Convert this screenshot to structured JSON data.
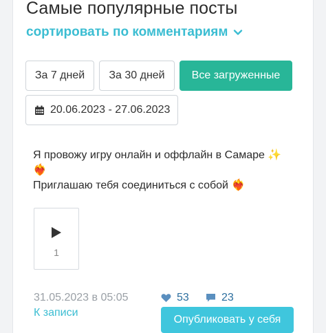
{
  "header": {
    "title": "Самые популярные посты",
    "sort_label": "сортировать по комментариям"
  },
  "filters": {
    "buttons": [
      "За 7 дней",
      "За 30 дней",
      "Все загруженные"
    ],
    "active": "Все загруженные",
    "date_range": "20.06.2023 - 27.06.2023"
  },
  "post": {
    "line1": "Я провожу игру онлайн и оффлайн в Самаре ✨",
    "line2": "❤️‍🔥",
    "line3": "Приглашаю тебя соединиться с собой ❤️‍🔥",
    "media_count": "1",
    "date": "31.05.2023 в 05:05",
    "link": "К записи",
    "likes": "53",
    "comments": "23",
    "publish_label": "Опубликовать у себя"
  },
  "colors": {
    "accent_teal": "#28b698",
    "accent_cyan": "#3bbdd2",
    "stat_blue": "#2b6e9e"
  }
}
